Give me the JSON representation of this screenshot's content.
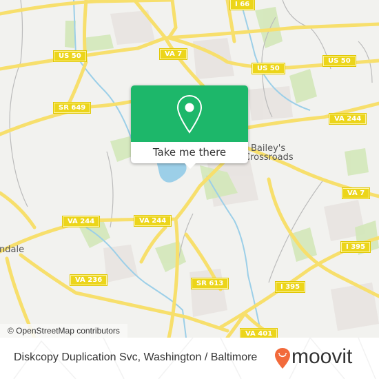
{
  "map": {
    "attribution": "© OpenStreetMap contributors",
    "road_shields": [
      {
        "id": "i66",
        "label": "I 66"
      },
      {
        "id": "us50-w",
        "label": "US 50"
      },
      {
        "id": "va7-n",
        "label": "VA 7"
      },
      {
        "id": "us50-e",
        "label": "US 50"
      },
      {
        "id": "us50-ne",
        "label": "US 50"
      },
      {
        "id": "sr649",
        "label": "SR 649"
      },
      {
        "id": "va244-e",
        "label": "VA 244"
      },
      {
        "id": "va244-w",
        "label": "VA 244"
      },
      {
        "id": "va244-c",
        "label": "VA 244"
      },
      {
        "id": "va7-e",
        "label": "VA 7"
      },
      {
        "id": "i395-e",
        "label": "I 395"
      },
      {
        "id": "va236",
        "label": "VA 236"
      },
      {
        "id": "sr613",
        "label": "SR 613"
      },
      {
        "id": "i395-s",
        "label": "I 395"
      },
      {
        "id": "va401",
        "label": "VA 401"
      }
    ],
    "places": [
      {
        "id": "baileys",
        "line1": "Bailey's",
        "line2": "Crossroads"
      },
      {
        "id": "annandale",
        "line1": "ndale"
      }
    ]
  },
  "popup": {
    "icon": "map-pin-icon",
    "button_label": "Take me there",
    "color": "#1db76a"
  },
  "footer": {
    "title": "Diskcopy Duplication Svc, Washington / Baltimore",
    "brand": "moovit",
    "brand_color": "#f26a3b",
    "brand_icon": "moovit-smiley-pin-icon"
  }
}
